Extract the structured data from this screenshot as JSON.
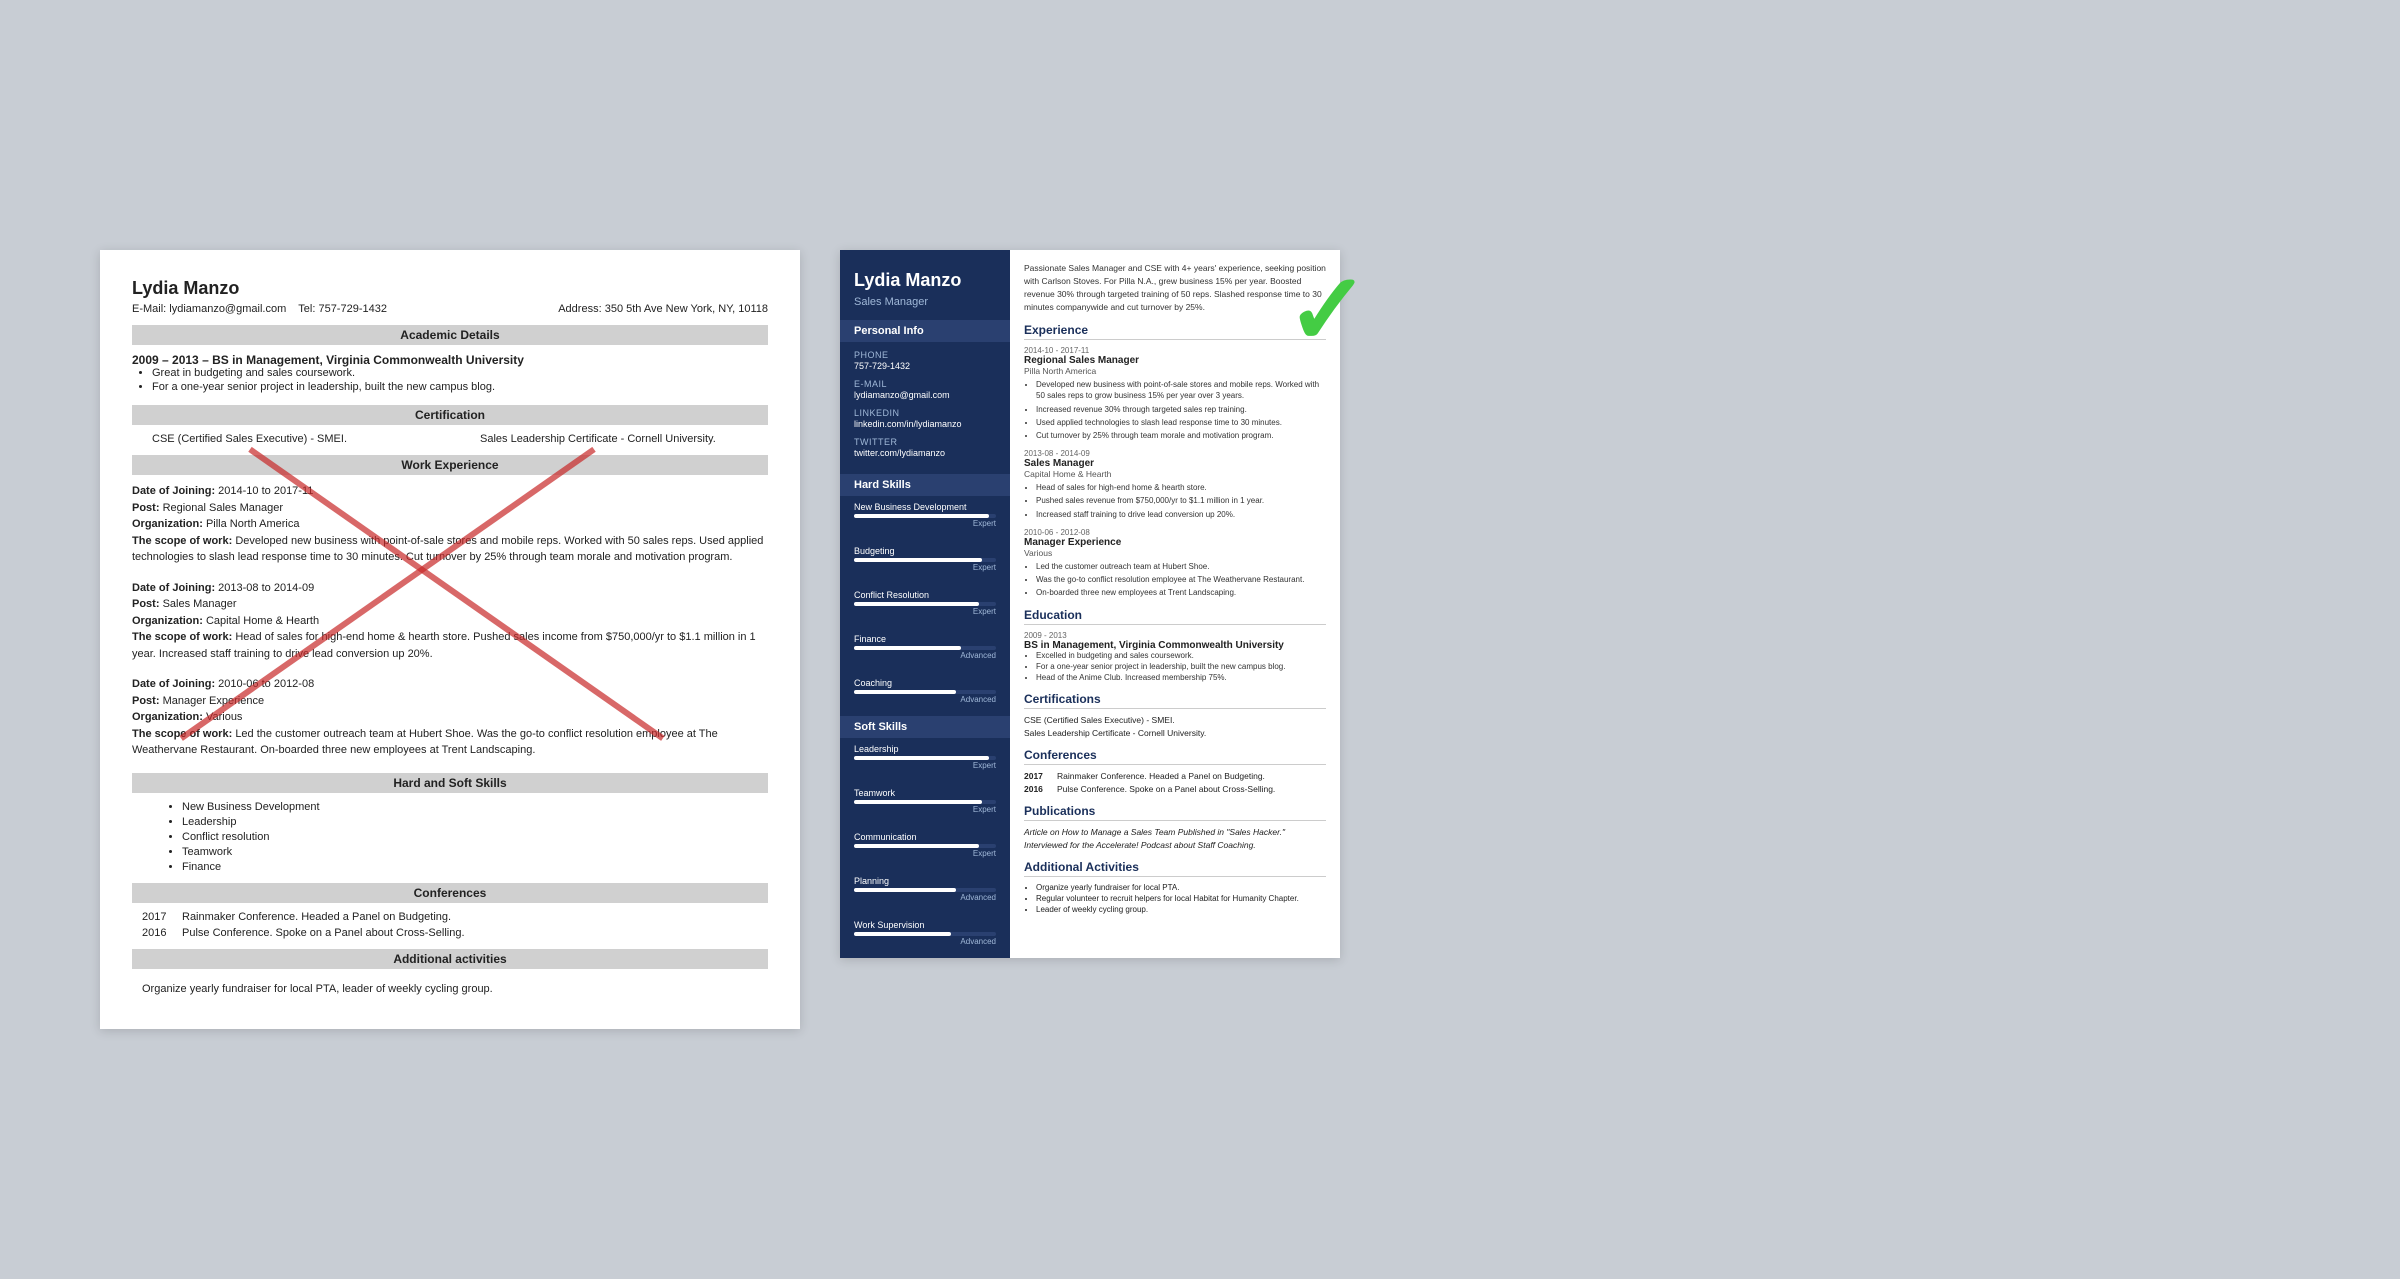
{
  "left_resume": {
    "name": "Lydia Manzo",
    "email_label": "E-Mail:",
    "email": "lydiamanzо@gmail.com",
    "address_label": "Address:",
    "address": "350 5th Ave New York, NY, 10118",
    "tel_label": "Tel:",
    "tel": "757-729-1432",
    "sections": {
      "academic": "Academic Details",
      "certification": "Certification",
      "work_experience": "Work Experience",
      "hard_soft_skills": "Hard and Soft Skills",
      "conferences": "Conferences",
      "additional": "Additional activities"
    },
    "education": {
      "years": "2009 – 2013 –",
      "degree": "BS in Management, Virginia Commonwealth University",
      "bullets": [
        "Great in budgeting and sales coursework.",
        "For a one-year senior project in leadership, built the new campus blog."
      ]
    },
    "certifications": [
      "CSE (Certified Sales Executive) - SMEI.",
      "Sales Leadership Certificate - Cornell University."
    ],
    "work": [
      {
        "date_label": "Date of Joining:",
        "dates": "2014-10 to 2017-11",
        "post_label": "Post:",
        "post": "Regional Sales Manager",
        "org_label": "Organization:",
        "org": "Pilla North America",
        "scope_label": "The scope of work:",
        "scope": "Developed new business with point-of-sale stores and mobile reps. Worked with 50 sales reps. Used applied technologies to slash lead response time to 30 minutes. Cut turnover by 25% through team morale and motivation program."
      },
      {
        "date_label": "Date of Joining:",
        "dates": "2013-08 to 2014-09",
        "post_label": "Post:",
        "post": "Sales Manager",
        "org_label": "Organization:",
        "org": "Capital Home & Hearth",
        "scope_label": "The scope of work:",
        "scope": "Head of sales for high-end home & hearth store. Pushed sales income from $750,000/yr to $1.1 million in 1 year. Increased staff training to drive lead conversion up 20%."
      },
      {
        "date_label": "Date of Joining:",
        "dates": "2010-06 to 2012-08",
        "post_label": "Post:",
        "post": "Manager Experience",
        "org_label": "Organization:",
        "org": "Various",
        "scope_label": "The scope of work:",
        "scope": "Led the customer outreach team at Hubert Shoe. Was the go-to conflict resolution employee at The Weathervane Restaurant. On-boarded three new employees at Trent Landscaping."
      }
    ],
    "skills": [
      "New Business Development",
      "Leadership",
      "Conflict resolution",
      "Teamwork",
      "Finance"
    ],
    "conferences": [
      {
        "year": "2017",
        "text": "Rainmaker Conference. Headed a Panel on Budgeting."
      },
      {
        "year": "2016",
        "text": "Pulse Conference. Spoke on a Panel about Cross-Selling."
      }
    ],
    "additional": "Organize yearly fundraiser for local PTA, leader of weekly cycling group."
  },
  "right_resume": {
    "name": "Lydia Manzo",
    "title": "Sales Manager",
    "summary": "Passionate Sales Manager and CSE with 4+ years' experience, seeking position with Carlson Stoves. For Pilla N.A., grew business 15% per year. Boosted revenue 30% through targeted training of 50 reps. Slashed response time to 30 minutes companywide and cut turnover by 25%.",
    "personal_info_label": "Personal Info",
    "phone_label": "Phone",
    "phone": "757-729-1432",
    "email_label": "E-mail",
    "email": "lydiamanzо@gmail.com",
    "linkedin_label": "LinkedIn",
    "linkedin": "linkedin.com/in/lydiamanzo",
    "twitter_label": "Twitter",
    "twitter": "twitter.com/lydiamanzo",
    "hard_skills_label": "Hard Skills",
    "hard_skills": [
      {
        "name": "New Business Development",
        "pct": 95,
        "level": "Expert"
      },
      {
        "name": "Budgeting",
        "pct": 90,
        "level": "Expert"
      },
      {
        "name": "Conflict Resolution",
        "pct": 88,
        "level": "Expert"
      },
      {
        "name": "Finance",
        "pct": 75,
        "level": "Advanced"
      },
      {
        "name": "Coaching",
        "pct": 72,
        "level": "Advanced"
      }
    ],
    "soft_skills_label": "Soft Skills",
    "soft_skills": [
      {
        "name": "Leadership",
        "pct": 95,
        "level": "Expert"
      },
      {
        "name": "Teamwork",
        "pct": 90,
        "level": "Expert"
      },
      {
        "name": "Communication",
        "pct": 88,
        "level": "Expert"
      },
      {
        "name": "Planning",
        "pct": 72,
        "level": "Advanced"
      },
      {
        "name": "Work Supervision",
        "pct": 68,
        "level": "Advanced"
      }
    ],
    "experience_label": "Experience",
    "experience": [
      {
        "dates": "2014-10 - 2017-11",
        "title": "Regional Sales Manager",
        "company": "Pilla North America",
        "bullets": [
          "Developed new business with point-of-sale stores and mobile reps. Worked with 50 sales reps to grow business 15% per year over 3 years.",
          "Increased revenue 30% through targeted sales rep training.",
          "Used applied technologies to slash lead response time to 30 minutes.",
          "Cut turnover by 25% through team morale and motivation program."
        ]
      },
      {
        "dates": "2013-08 - 2014-09",
        "title": "Sales Manager",
        "company": "Capital Home & Hearth",
        "bullets": [
          "Head of sales for high-end home & hearth store.",
          "Pushed sales revenue from $750,000/yr to $1.1 million in 1 year.",
          "Increased staff training to drive lead conversion up 20%."
        ]
      },
      {
        "dates": "2010-06 - 2012-08",
        "title": "Manager Experience",
        "company": "Various",
        "bullets": [
          "Led the customer outreach team at Hubert Shoe.",
          "Was the go-to conflict resolution employee at The Weathervane Restaurant.",
          "On-boarded three new employees at Trent Landscaping."
        ]
      }
    ],
    "education_label": "Education",
    "education": {
      "dates": "2009 - 2013",
      "degree": "BS in Management, Virginia Commonwealth University",
      "bullets": [
        "Excelled in budgeting and sales coursework.",
        "For a one-year senior project in leadership, built the new campus blog.",
        "Head of the Anime Club. Increased membership 75%."
      ]
    },
    "certifications_label": "Certifications",
    "certifications": [
      "CSE (Certified Sales Executive) - SMEI.",
      "Sales Leadership Certificate - Cornell University."
    ],
    "conferences_label": "Conferences",
    "conferences": [
      {
        "year": "2017",
        "text": "Rainmaker Conference. Headed a Panel on Budgeting."
      },
      {
        "year": "2016",
        "text": "Pulse Conference. Spoke on a Panel about Cross-Selling."
      }
    ],
    "publications_label": "Publications",
    "publications": [
      "Article on How to Manage a Sales Team Published in \"Sales Hacker.\"",
      "Interviewed for the Accelerate! Podcast about Staff Coaching."
    ],
    "additional_label": "Additional Activities",
    "additional_bullets": [
      "Organize yearly fundraiser for local PTA.",
      "Regular volunteer to recruit helpers for local Habitat for Humanity Chapter.",
      "Leader of weekly cycling group."
    ]
  }
}
